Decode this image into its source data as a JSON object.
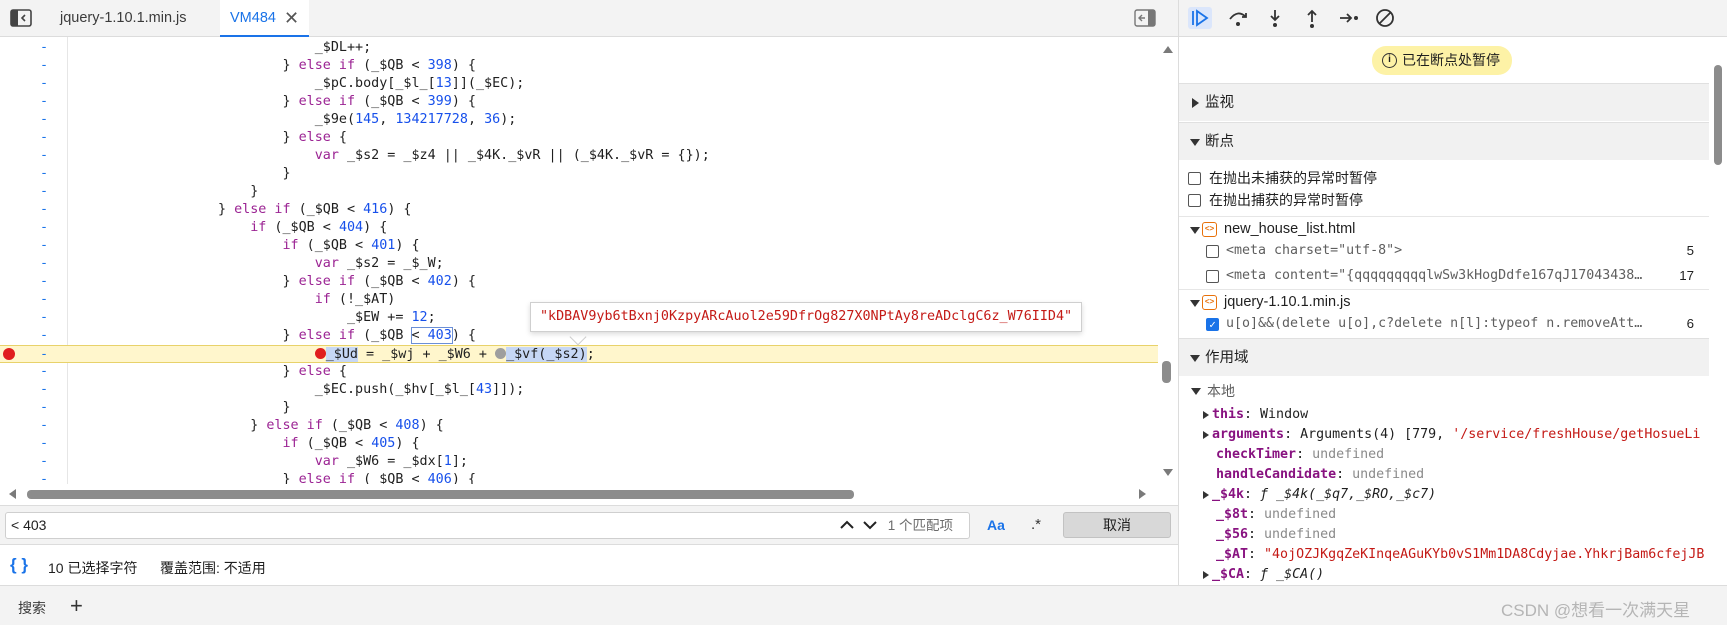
{
  "tabs": [
    {
      "label": "jquery-1.10.1.min.js",
      "active": false
    },
    {
      "label": "VM484",
      "active": true,
      "close": "✕"
    }
  ],
  "code_lines": [
    {
      "num": "-",
      "html_key": "l0"
    },
    {
      "num": "-",
      "html_key": "l1"
    }
  ],
  "code": {
    "l00": "            _$DL++;",
    "l01": "        } else if (_$QB < 398) {",
    "l02": "            _$pC.body[_$l_[13]](_$EC);",
    "l03": "        } else if (_$QB < 399) {",
    "l04": "            _$9e(145, 134217728, 36);",
    "l05": "        } else {",
    "l06": "            var _$s2 = _$z4 || _$4K._$vR || (_$4K._$vR = {});",
    "l07": "        }",
    "l08": "    }",
    "l09": "} else if (_$QB < 416) {",
    "l10": "    if (_$QB < 404) {",
    "l11": "        if (_$QB < 401) {",
    "l12": "            var _$s2 = _$_W;",
    "l13": "        } else if (_$QB < 402) {",
    "l14": "            if (!_$AT)",
    "l15": "                _$EW += 12;",
    "l16": "        } else if (_$QB < 403) {",
    "l17": "            _$Ud = _$wj + _$W6 + _$vf(_$s2);",
    "l18": "        } else {",
    "l19": "            _$EC.push(_$hv[_$l_[43]]);",
    "l20": "        }",
    "l21": "    } else if (_$QB < 408) {",
    "l22": "        if (_$QB < 405) {",
    "l23": "            var _$W6 = _$dx[1];",
    "l24": "        } else if ( $QB < 406) {"
  },
  "line_marker": "-",
  "tooltip": "\"kDBAV9yb6tBxnj0KzpyARcAuol2e59DfrOg827X0NPtAy8reADclgC6z_W76IID4\"",
  "search": {
    "value": "< 403",
    "match_count": "1 个匹配项",
    "aa": "Aa",
    "regex": ".*",
    "cancel": "取消"
  },
  "status": {
    "braces": "{ }",
    "selected": "10 已选择字符",
    "coverage": "覆盖范围: 不适用"
  },
  "debugger": {
    "paused_banner": "已在断点处暂停",
    "watch": "监视",
    "breakpoints": "断点",
    "pause_uncaught": "在抛出未捕获的异常时暂停",
    "pause_caught": "在抛出捕获的异常时暂停",
    "files": [
      {
        "name": "new_house_list.html",
        "breakpoints": [
          {
            "code": "<meta charset=\"utf-8\">",
            "line": "5",
            "checked": false
          },
          {
            "code": "<meta content=\"{qqqqqqqqqlwSw3kHogDdfe167qJ170434382…",
            "line": "17",
            "checked": false
          }
        ]
      },
      {
        "name": "jquery-1.10.1.min.js",
        "breakpoints": [
          {
            "code": "u[o]&&(delete u[o],c?delete n[l]:typeof n.removeAttr…",
            "line": "6",
            "checked": true
          }
        ]
      }
    ],
    "scope": "作用域",
    "local": "本地",
    "scope_items": [
      {
        "key": "this",
        "value": "Window",
        "type": "obj",
        "expandable": true
      },
      {
        "key": "arguments",
        "value_prefix": "Arguments(4) [779, ",
        "value": "'/service/freshHouse/getHosueLi",
        "type": "args",
        "expandable": true
      },
      {
        "key": "checkTimer",
        "value": "undefined",
        "type": "undef",
        "expandable": false
      },
      {
        "key": "handleCandidate",
        "value": "undefined",
        "type": "undef",
        "expandable": false
      },
      {
        "key": "_$4k",
        "value": "ƒ _$4k(_$q7,_$RO,_$c7)",
        "type": "fn",
        "expandable": true
      },
      {
        "key": "_$8t",
        "value": "undefined",
        "type": "undef",
        "expandable": false
      },
      {
        "key": "_$56",
        "value": "undefined",
        "type": "undef",
        "expandable": false
      },
      {
        "key": "_$AT",
        "value": "\"4ojOZJKgqZeKInqeAGuKYb0vS1Mm1DA8Cdyjae.YhkrjBam6cfejJB",
        "type": "str",
        "expandable": false
      },
      {
        "key": "_$CA",
        "value": "ƒ _$CA()",
        "type": "fn",
        "expandable": true
      }
    ]
  },
  "bottom": {
    "search_tab": "搜索",
    "plus": "+",
    "watermark": "CSDN @想看一次满天星"
  },
  "colors": {
    "accent": "#1a73e8",
    "paused_line": "#fff6cc",
    "breakpoint": "#e01e1e",
    "banner": "#fdf2a6"
  }
}
